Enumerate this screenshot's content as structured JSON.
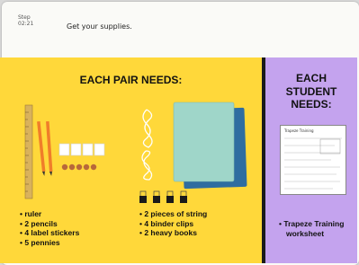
{
  "header": {
    "step_label": "Step",
    "step_number": "02:21",
    "title": "Get your supplies."
  },
  "pair_section": {
    "heading": "EACH PAIR NEEDS:",
    "items_left": [
      "ruler",
      "2 pencils",
      "4 label stickers",
      "5 pennies"
    ],
    "items_right": [
      "2 pieces of string",
      "4 binder clips",
      "2 heavy books"
    ]
  },
  "student_section": {
    "heading_line1": "EACH",
    "heading_line2": "STUDENT",
    "heading_line3": "NEEDS:",
    "worksheet_title": "Trapeze Training",
    "items": [
      "Trapeze Training worksheet"
    ]
  },
  "colors": {
    "yellow_panel": "#ffd83a",
    "purple_panel": "#c4a3ee",
    "divider": "#1a1a1a"
  }
}
